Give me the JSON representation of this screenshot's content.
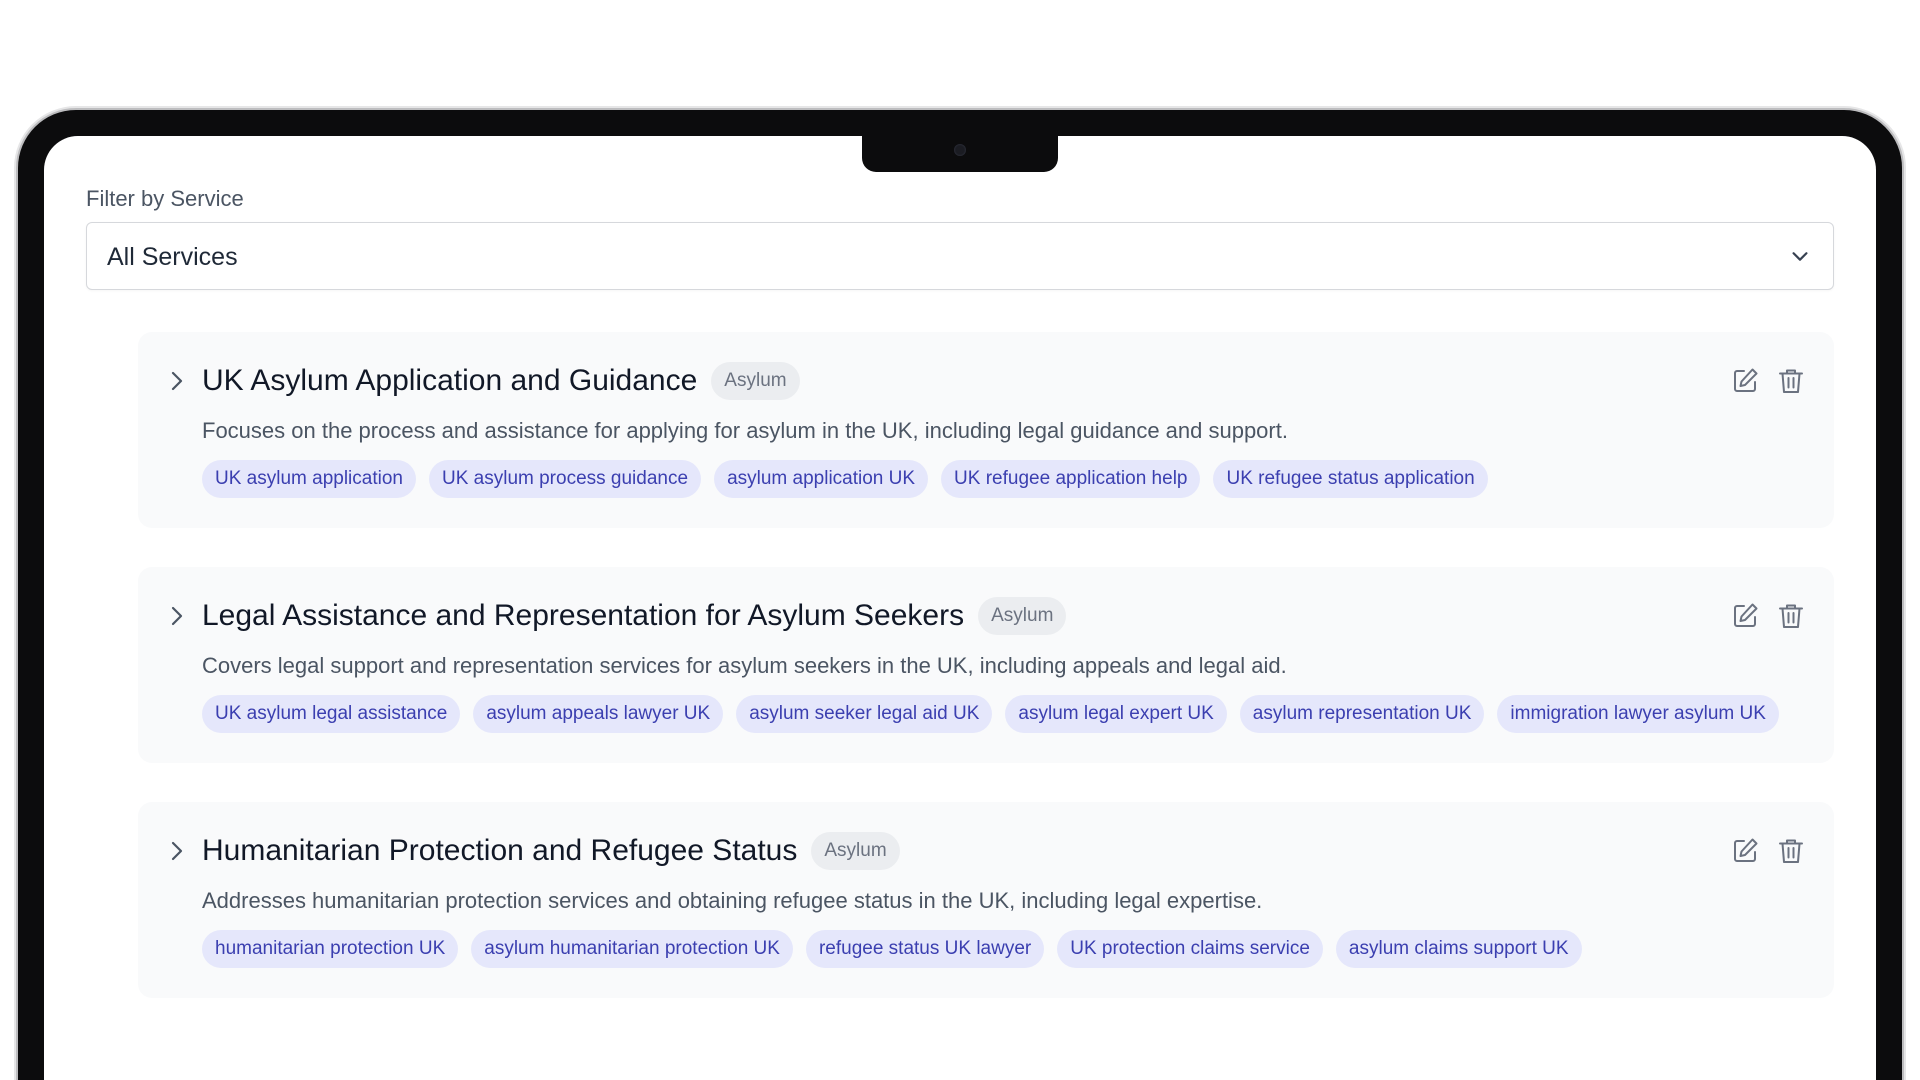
{
  "filter": {
    "label": "Filter by Service",
    "selected": "All Services"
  },
  "clusters": [
    {
      "title": "UK Asylum Application and Guidance",
      "badge": "Asylum",
      "description": "Focuses on the process and assistance for applying for asylum in the UK, including legal guidance and support.",
      "tags": [
        "UK asylum application",
        "UK asylum process guidance",
        "asylum application UK",
        "UK refugee application help",
        "UK refugee status application"
      ]
    },
    {
      "title": "Legal Assistance and Representation for Asylum Seekers",
      "badge": "Asylum",
      "description": "Covers legal support and representation services for asylum seekers in the UK, including appeals and legal aid.",
      "tags": [
        "UK asylum legal assistance",
        "asylum appeals lawyer UK",
        "asylum seeker legal aid UK",
        "asylum legal expert UK",
        "asylum representation UK",
        "immigration lawyer asylum UK"
      ]
    },
    {
      "title": "Humanitarian Protection and Refugee Status",
      "badge": "Asylum",
      "description": "Addresses humanitarian protection services and obtaining refugee status in the UK, including legal expertise.",
      "tags": [
        "humanitarian protection UK",
        "asylum humanitarian protection UK",
        "refugee status UK lawyer",
        "UK protection claims service",
        "asylum claims support UK"
      ]
    }
  ]
}
